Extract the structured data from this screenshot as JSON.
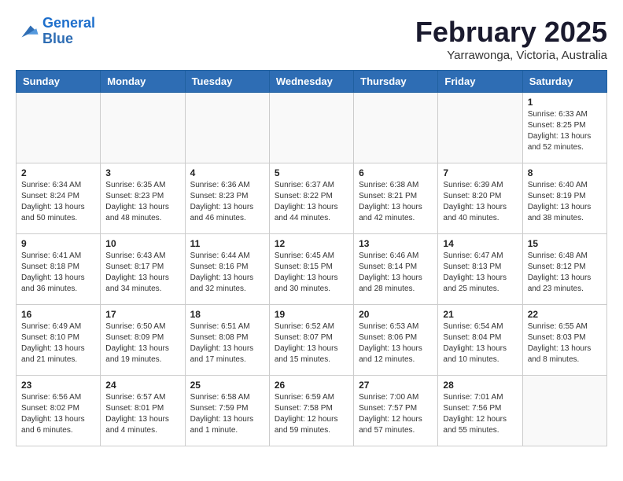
{
  "header": {
    "logo_line1": "General",
    "logo_line2": "Blue",
    "month_title": "February 2025",
    "location": "Yarrawonga, Victoria, Australia"
  },
  "weekdays": [
    "Sunday",
    "Monday",
    "Tuesday",
    "Wednesday",
    "Thursday",
    "Friday",
    "Saturday"
  ],
  "weeks": [
    [
      {
        "day": "",
        "info": ""
      },
      {
        "day": "",
        "info": ""
      },
      {
        "day": "",
        "info": ""
      },
      {
        "day": "",
        "info": ""
      },
      {
        "day": "",
        "info": ""
      },
      {
        "day": "",
        "info": ""
      },
      {
        "day": "1",
        "info": "Sunrise: 6:33 AM\nSunset: 8:25 PM\nDaylight: 13 hours\nand 52 minutes."
      }
    ],
    [
      {
        "day": "2",
        "info": "Sunrise: 6:34 AM\nSunset: 8:24 PM\nDaylight: 13 hours\nand 50 minutes."
      },
      {
        "day": "3",
        "info": "Sunrise: 6:35 AM\nSunset: 8:23 PM\nDaylight: 13 hours\nand 48 minutes."
      },
      {
        "day": "4",
        "info": "Sunrise: 6:36 AM\nSunset: 8:23 PM\nDaylight: 13 hours\nand 46 minutes."
      },
      {
        "day": "5",
        "info": "Sunrise: 6:37 AM\nSunset: 8:22 PM\nDaylight: 13 hours\nand 44 minutes."
      },
      {
        "day": "6",
        "info": "Sunrise: 6:38 AM\nSunset: 8:21 PM\nDaylight: 13 hours\nand 42 minutes."
      },
      {
        "day": "7",
        "info": "Sunrise: 6:39 AM\nSunset: 8:20 PM\nDaylight: 13 hours\nand 40 minutes."
      },
      {
        "day": "8",
        "info": "Sunrise: 6:40 AM\nSunset: 8:19 PM\nDaylight: 13 hours\nand 38 minutes."
      }
    ],
    [
      {
        "day": "9",
        "info": "Sunrise: 6:41 AM\nSunset: 8:18 PM\nDaylight: 13 hours\nand 36 minutes."
      },
      {
        "day": "10",
        "info": "Sunrise: 6:43 AM\nSunset: 8:17 PM\nDaylight: 13 hours\nand 34 minutes."
      },
      {
        "day": "11",
        "info": "Sunrise: 6:44 AM\nSunset: 8:16 PM\nDaylight: 13 hours\nand 32 minutes."
      },
      {
        "day": "12",
        "info": "Sunrise: 6:45 AM\nSunset: 8:15 PM\nDaylight: 13 hours\nand 30 minutes."
      },
      {
        "day": "13",
        "info": "Sunrise: 6:46 AM\nSunset: 8:14 PM\nDaylight: 13 hours\nand 28 minutes."
      },
      {
        "day": "14",
        "info": "Sunrise: 6:47 AM\nSunset: 8:13 PM\nDaylight: 13 hours\nand 25 minutes."
      },
      {
        "day": "15",
        "info": "Sunrise: 6:48 AM\nSunset: 8:12 PM\nDaylight: 13 hours\nand 23 minutes."
      }
    ],
    [
      {
        "day": "16",
        "info": "Sunrise: 6:49 AM\nSunset: 8:10 PM\nDaylight: 13 hours\nand 21 minutes."
      },
      {
        "day": "17",
        "info": "Sunrise: 6:50 AM\nSunset: 8:09 PM\nDaylight: 13 hours\nand 19 minutes."
      },
      {
        "day": "18",
        "info": "Sunrise: 6:51 AM\nSunset: 8:08 PM\nDaylight: 13 hours\nand 17 minutes."
      },
      {
        "day": "19",
        "info": "Sunrise: 6:52 AM\nSunset: 8:07 PM\nDaylight: 13 hours\nand 15 minutes."
      },
      {
        "day": "20",
        "info": "Sunrise: 6:53 AM\nSunset: 8:06 PM\nDaylight: 13 hours\nand 12 minutes."
      },
      {
        "day": "21",
        "info": "Sunrise: 6:54 AM\nSunset: 8:04 PM\nDaylight: 13 hours\nand 10 minutes."
      },
      {
        "day": "22",
        "info": "Sunrise: 6:55 AM\nSunset: 8:03 PM\nDaylight: 13 hours\nand 8 minutes."
      }
    ],
    [
      {
        "day": "23",
        "info": "Sunrise: 6:56 AM\nSunset: 8:02 PM\nDaylight: 13 hours\nand 6 minutes."
      },
      {
        "day": "24",
        "info": "Sunrise: 6:57 AM\nSunset: 8:01 PM\nDaylight: 13 hours\nand 4 minutes."
      },
      {
        "day": "25",
        "info": "Sunrise: 6:58 AM\nSunset: 7:59 PM\nDaylight: 13 hours\nand 1 minute."
      },
      {
        "day": "26",
        "info": "Sunrise: 6:59 AM\nSunset: 7:58 PM\nDaylight: 12 hours\nand 59 minutes."
      },
      {
        "day": "27",
        "info": "Sunrise: 7:00 AM\nSunset: 7:57 PM\nDaylight: 12 hours\nand 57 minutes."
      },
      {
        "day": "28",
        "info": "Sunrise: 7:01 AM\nSunset: 7:56 PM\nDaylight: 12 hours\nand 55 minutes."
      },
      {
        "day": "",
        "info": ""
      }
    ]
  ]
}
